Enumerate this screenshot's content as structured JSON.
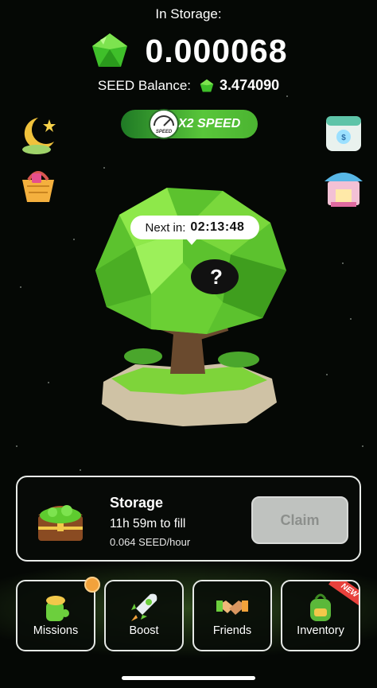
{
  "header": {
    "storage_label": "In Storage:",
    "storage_value": "0.000068",
    "balance_label": "SEED Balance:",
    "balance_value": "3.474090",
    "gem_icon": "green-gem-icon"
  },
  "speed_badge": {
    "label": "X2 SPEED",
    "gauge_label": "SPEED"
  },
  "side_icons": {
    "left": [
      "moon-star-icon",
      "shopping-basket-icon"
    ],
    "right": [
      "calendar-icon",
      "shop-icon"
    ]
  },
  "tree": {
    "next_label": "Next in:",
    "next_time": "02:13:48",
    "mystery_symbol": "?"
  },
  "storage_card": {
    "title": "Storage",
    "fill_text": "11h 59m to fill",
    "rate_text": "0.064 SEED/hour",
    "claim_label": "Claim"
  },
  "nav": {
    "missions": "Missions",
    "boost": "Boost",
    "friends": "Friends",
    "inventory": "Inventory",
    "new_badge": "NEW"
  },
  "colors": {
    "background": "#050805",
    "accent_green": "#59c63a",
    "claim_disabled": "#bfc2bf",
    "notification": "#f2a23b",
    "new_badge": "#e8413c"
  }
}
